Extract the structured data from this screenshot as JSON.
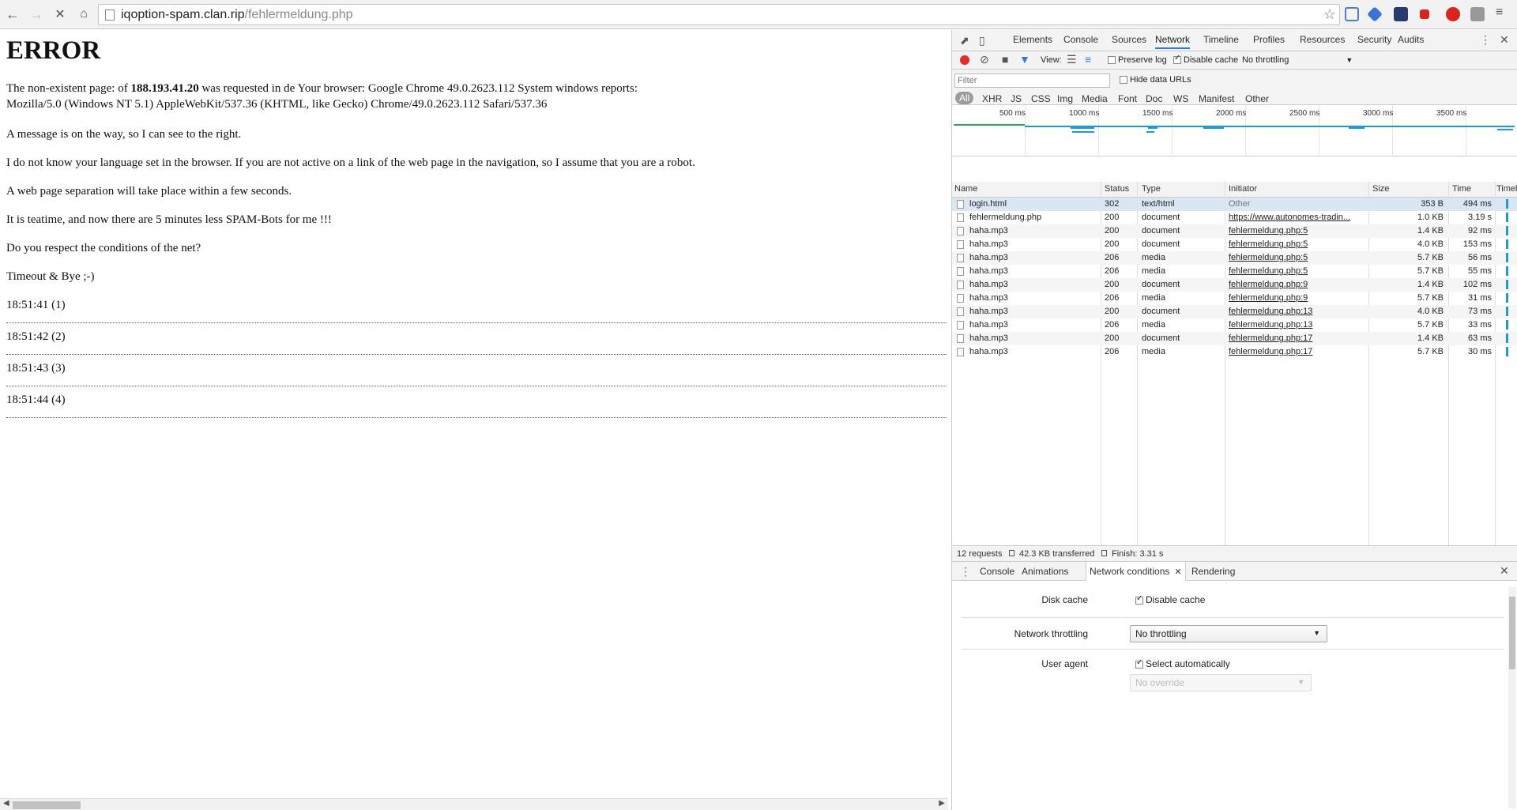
{
  "browser": {
    "url_host": "iqoption-spam.clan.rip",
    "url_path": "/fehlermeldung.php",
    "icons": [
      "back-arrow-icon",
      "forward-arrow-icon",
      "stop-icon",
      "home-icon",
      "star-icon",
      "menu-icon"
    ]
  },
  "page": {
    "heading": "ERROR",
    "line1_prefix": "The non-existent page: of ",
    "line1_ip": "188.193.41.20",
    "line1_suffix": " was requested in de Your browser: Google Chrome 49.0.2623.112 System windows reports:",
    "line2": "Mozilla/5.0 (Windows NT 5.1) AppleWebKit/537.36 (KHTML, like Gecko) Chrome/49.0.2623.112 Safari/537.36",
    "p_message": "A message is on the way, so I can see to the right.",
    "p_language": "I do not know your language set in the browser. If you are not active on a link of the web page in the navigation, so I assume that you are a robot.",
    "p_separation": "A web page separation will take place within a few seconds.",
    "p_teatime": "It is teatime, and now there are 5 minutes less SPAM-Bots for me !!!",
    "p_respect": "Do you respect the conditions of the net?",
    "p_timeout": "Timeout & Bye ;-)",
    "times": [
      "18:51:41 (1)",
      "18:51:42 (2)",
      "18:51:43 (3)",
      "18:51:44 (4)"
    ]
  },
  "devtools": {
    "tabs": [
      "Elements",
      "Console",
      "Sources",
      "Network",
      "Timeline",
      "Profiles",
      "Resources",
      "Security",
      "Audits"
    ],
    "active_tab": "Network",
    "toolbar": {
      "view_label": "View:",
      "preserve_log": "Preserve log",
      "disable_cache": "Disable cache",
      "throttling": "No throttling"
    },
    "filter_placeholder": "Filter",
    "hide_data_urls": "Hide data URLs",
    "type_filters": [
      "All",
      "XHR",
      "JS",
      "CSS",
      "Img",
      "Media",
      "Font",
      "Doc",
      "WS",
      "Manifest",
      "Other"
    ],
    "overview_ticks": [
      "500 ms",
      "1000 ms",
      "1500 ms",
      "2000 ms",
      "2500 ms",
      "3000 ms",
      "3500 ms"
    ],
    "columns": [
      "Name",
      "Status",
      "Type",
      "Initiator",
      "Size",
      "Time",
      "Timeline"
    ],
    "rows": [
      {
        "name": "login.html",
        "status": "302",
        "type": "text/html",
        "initiator": "Other",
        "size": "353 B",
        "time": "494 ms"
      },
      {
        "name": "fehlermeldung.php",
        "status": "200",
        "type": "document",
        "initiator": "https://www.autonomes-tradin...",
        "size": "1.0 KB",
        "time": "3.19 s"
      },
      {
        "name": "haha.mp3",
        "status": "200",
        "type": "document",
        "initiator": "fehlermeldung.php:5",
        "size": "1.4 KB",
        "time": "92 ms"
      },
      {
        "name": "haha.mp3",
        "status": "200",
        "type": "document",
        "initiator": "fehlermeldung.php:5",
        "size": "4.0 KB",
        "time": "153 ms"
      },
      {
        "name": "haha.mp3",
        "status": "206",
        "type": "media",
        "initiator": "fehlermeldung.php:5",
        "size": "5.7 KB",
        "time": "56 ms"
      },
      {
        "name": "haha.mp3",
        "status": "206",
        "type": "media",
        "initiator": "fehlermeldung.php:5",
        "size": "5.7 KB",
        "time": "55 ms"
      },
      {
        "name": "haha.mp3",
        "status": "200",
        "type": "document",
        "initiator": "fehlermeldung.php:9",
        "size": "1.4 KB",
        "time": "102 ms"
      },
      {
        "name": "haha.mp3",
        "status": "206",
        "type": "media",
        "initiator": "fehlermeldung.php:9",
        "size": "5.7 KB",
        "time": "31 ms"
      },
      {
        "name": "haha.mp3",
        "status": "200",
        "type": "document",
        "initiator": "fehlermeldung.php:13",
        "size": "4.0 KB",
        "time": "73 ms"
      },
      {
        "name": "haha.mp3",
        "status": "206",
        "type": "media",
        "initiator": "fehlermeldung.php:13",
        "size": "5.7 KB",
        "time": "33 ms"
      },
      {
        "name": "haha.mp3",
        "status": "200",
        "type": "document",
        "initiator": "fehlermeldung.php:17",
        "size": "1.4 KB",
        "time": "63 ms"
      },
      {
        "name": "haha.mp3",
        "status": "206",
        "type": "media",
        "initiator": "fehlermeldung.php:17",
        "size": "5.7 KB",
        "time": "30 ms"
      }
    ],
    "summary": {
      "requests": "12 requests",
      "transferred": "42.3 KB transferred",
      "finish": "Finish: 3.31 s"
    },
    "drawer": {
      "tabs": [
        "Console",
        "Animations",
        "Network conditions",
        "Rendering"
      ],
      "active_tab": "Network conditions",
      "disk_cache_label": "Disk cache",
      "disk_cache_option": "Disable cache",
      "throttling_label": "Network throttling",
      "throttling_value": "No throttling",
      "user_agent_label": "User agent",
      "user_agent_option": "Select automatically",
      "override_value": "No override"
    },
    "colors": {
      "accent": "#3879d9",
      "record": "#e32b2b",
      "waterfall": "#1e9bd6"
    }
  }
}
